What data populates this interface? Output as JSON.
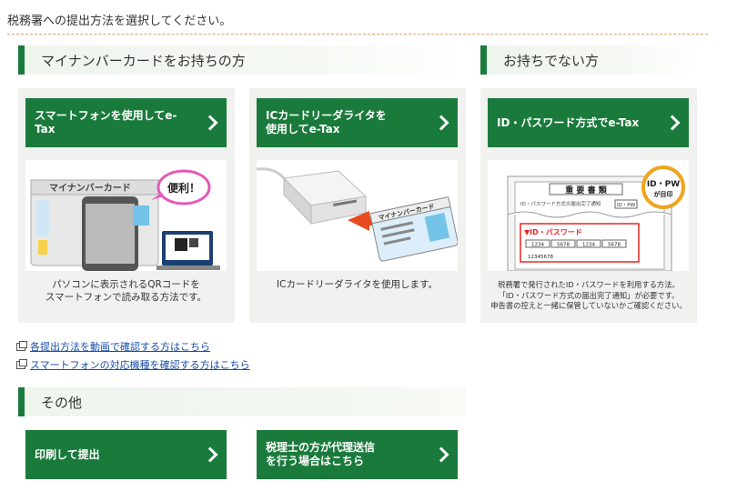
{
  "instruction": "税務署への提出方法を選択してください。",
  "section_mynumber": {
    "title": "マイナンバーカードをお持ちの方"
  },
  "section_none": {
    "title": "お持ちでない方"
  },
  "section_other": {
    "title": "その他"
  },
  "cards": {
    "smartphone": {
      "button": "スマートフォンを使用してe-Tax",
      "card_label": "マイナンバーカード",
      "balloon": "便利！",
      "description": "パソコンに表示されるQRコードを\nスマートフォンで読み取る方法です。"
    },
    "icreader": {
      "button": "ICカードリーダライタを\n使用してe-Tax",
      "card_label": "マイナンバーカード",
      "description": "ICカードリーダライタを使用します。"
    },
    "idpw": {
      "button": "ID・パスワード方式でe-Tax",
      "doc_title": "重 要 書 類",
      "doc_subtitle": "ID・パスワード方式の届出完了通知",
      "doc_tag": "ID・PW",
      "badge_top": "ID・PW",
      "badge_bottom": "が目印",
      "idpw_label": "▼ID・パスワード",
      "id_cells": [
        "1234",
        "5678",
        "1234",
        "5678"
      ],
      "pw_value": "12345678",
      "description": "税務署で発行されたID・パスワードを利用する方法。\n「ID・パスワード方式の届出完了通知」が必要です。\n申告書の控えと一緒に保管していないかご確認ください。"
    }
  },
  "links": [
    "各提出方法を動画で確認する方はこちら",
    "スマートフォンの対応機種を確認する方はこちら"
  ],
  "other_buttons": {
    "print": "印刷して提出",
    "accountant": "税理士の方が代理送信\nを行う場合はこちら"
  },
  "colors": {
    "accent_green": "#1a7a3c",
    "link_blue": "#1a4fa8",
    "card_bg": "#f1f1ef"
  }
}
